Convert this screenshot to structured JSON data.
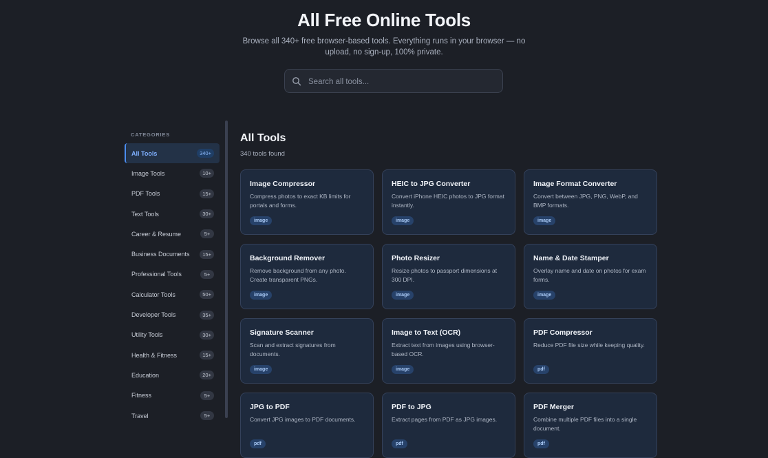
{
  "hero": {
    "title": "All Free Online Tools",
    "subtitle": "Browse all 340+ free browser-based tools. Everything runs in your browser — no upload, no sign-up, 100% private."
  },
  "search": {
    "placeholder": "Search all tools..."
  },
  "sidebar": {
    "title": "CATEGORIES",
    "items": [
      {
        "label": "All Tools",
        "count": "340+"
      },
      {
        "label": "Image Tools",
        "count": "10+"
      },
      {
        "label": "PDF Tools",
        "count": "15+"
      },
      {
        "label": "Text Tools",
        "count": "30+"
      },
      {
        "label": "Career & Resume",
        "count": "5+"
      },
      {
        "label": "Business Documents",
        "count": "15+"
      },
      {
        "label": "Professional Tools",
        "count": "5+"
      },
      {
        "label": "Calculator Tools",
        "count": "50+"
      },
      {
        "label": "Developer Tools",
        "count": "35+"
      },
      {
        "label": "Utility Tools",
        "count": "30+"
      },
      {
        "label": "Health & Fitness",
        "count": "15+"
      },
      {
        "label": "Education",
        "count": "20+"
      },
      {
        "label": "Fitness",
        "count": "5+"
      },
      {
        "label": "Travel",
        "count": "5+"
      }
    ]
  },
  "main": {
    "title": "All Tools",
    "count": "340 tools found",
    "cards": [
      {
        "title": "Image Compressor",
        "desc": "Compress photos to exact KB limits for portals and forms.",
        "tag": "image"
      },
      {
        "title": "HEIC to JPG Converter",
        "desc": "Convert iPhone HEIC photos to JPG format instantly.",
        "tag": "image"
      },
      {
        "title": "Image Format Converter",
        "desc": "Convert between JPG, PNG, WebP, and BMP formats.",
        "tag": "image"
      },
      {
        "title": "Background Remover",
        "desc": "Remove background from any photo. Create transparent PNGs.",
        "tag": "image"
      },
      {
        "title": "Photo Resizer",
        "desc": "Resize photos to passport dimensions at 300 DPI.",
        "tag": "image"
      },
      {
        "title": "Name & Date Stamper",
        "desc": "Overlay name and date on photos for exam forms.",
        "tag": "image"
      },
      {
        "title": "Signature Scanner",
        "desc": "Scan and extract signatures from documents.",
        "tag": "image"
      },
      {
        "title": "Image to Text (OCR)",
        "desc": "Extract text from images using browser-based OCR.",
        "tag": "image"
      },
      {
        "title": "PDF Compressor",
        "desc": "Reduce PDF file size while keeping quality.",
        "tag": "pdf"
      },
      {
        "title": "JPG to PDF",
        "desc": "Convert JPG images to PDF documents.",
        "tag": "pdf"
      },
      {
        "title": "PDF to JPG",
        "desc": "Extract pages from PDF as JPG images.",
        "tag": "pdf"
      },
      {
        "title": "PDF Merger",
        "desc": "Combine multiple PDF files into a single document.",
        "tag": "pdf"
      }
    ]
  }
}
